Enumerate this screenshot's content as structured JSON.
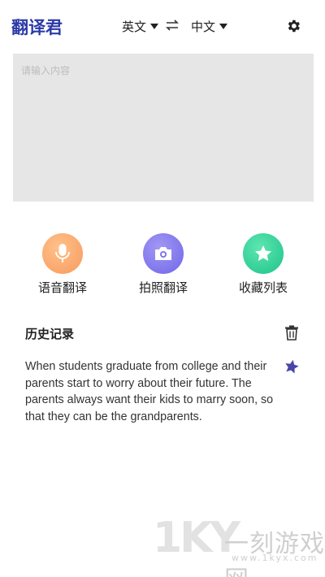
{
  "header": {
    "app_name": "翻译君",
    "source_lang": "英文",
    "target_lang": "中文"
  },
  "input": {
    "placeholder": "请输入内容",
    "value": ""
  },
  "functions": [
    {
      "label": "语音翻译",
      "icon": "microphone-icon"
    },
    {
      "label": "拍照翻译",
      "icon": "camera-icon"
    },
    {
      "label": "收藏列表",
      "icon": "star-icon"
    }
  ],
  "history": {
    "title": "历史记录",
    "items": [
      {
        "text": "When students graduate from college and their parents start to worry about their future. The parents always want their kids to marry soon, so that they can be the grandparents."
      }
    ]
  },
  "watermark": {
    "logo": "1KY",
    "text": "一刻游戏网",
    "url": "www.1kyx.com"
  },
  "colors": {
    "brand": "#2c3aa8",
    "voice": "#f79a5e",
    "photo": "#6f66e8",
    "favorite": "#1ec38a",
    "input_bg": "#e6e6e6"
  }
}
